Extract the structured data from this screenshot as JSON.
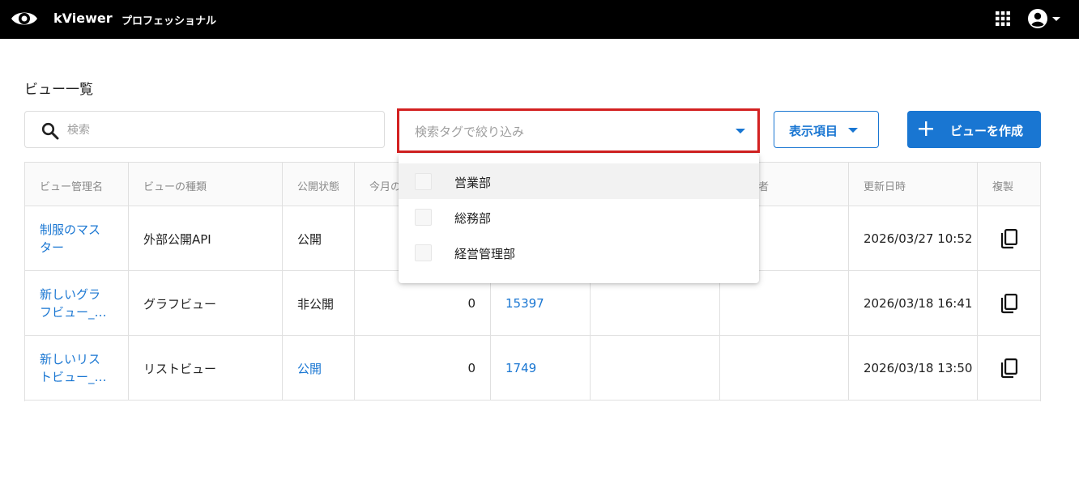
{
  "app": {
    "name": "kViewer",
    "edition": "プロフェッショナル"
  },
  "page": {
    "title": "ビュー一覧"
  },
  "search": {
    "placeholder": "検索"
  },
  "tag_filter": {
    "placeholder": "検索タグで絞り込み",
    "options": [
      {
        "label": "営業部",
        "checked": false
      },
      {
        "label": "総務部",
        "checked": false
      },
      {
        "label": "経営管理部",
        "checked": false
      }
    ]
  },
  "toolbar": {
    "display_items_label": "表示項目",
    "create_label": "ビューを作成"
  },
  "table": {
    "headers": [
      "ビュー管理名",
      "ビューの種類",
      "公開状態",
      "今月の",
      "",
      "",
      "者",
      "更新日時",
      "複製"
    ],
    "rows": [
      {
        "name_line1": "制服のマス",
        "name_line2": "ター",
        "type": "外部公開API",
        "status": "公開",
        "status_link": false,
        "monthly": "",
        "total": "",
        "updated": "2026/03/27 10:52"
      },
      {
        "name_line1": "新しいグラ",
        "name_line2": "フビュー_…",
        "type": "グラフビュー",
        "status": "非公開",
        "status_link": false,
        "monthly": "0",
        "total": "15397",
        "updated": "2026/03/18 16:41"
      },
      {
        "name_line1": "新しいリス",
        "name_line2": "トビュー_…",
        "type": "リストビュー",
        "status": "公開",
        "status_link": true,
        "monthly": "0",
        "total": "1749",
        "updated": "2026/03/18 13:50"
      }
    ]
  },
  "icons": {
    "logo": "eye-icon",
    "apps": "apps-grid-icon",
    "account": "account-circle-icon",
    "search": "search-icon",
    "plus": "plus-icon",
    "copy": "copy-icon",
    "caret": "caret-down-icon"
  },
  "colors": {
    "topbar": "#000000",
    "accent": "#1976d2",
    "highlight": "#d32121"
  }
}
